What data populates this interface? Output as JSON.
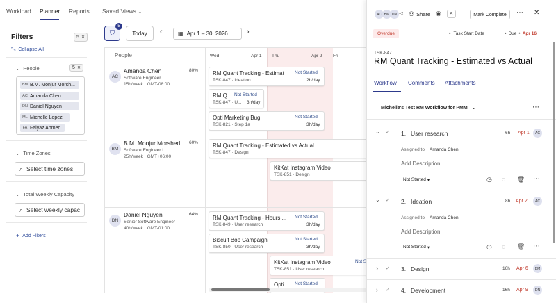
{
  "nav": {
    "tabs": [
      "Workload",
      "Planner",
      "Reports"
    ],
    "active": "Planner",
    "saved_views": "Saved Views"
  },
  "toolbar": {
    "filter_count": "5",
    "today": "Today",
    "date_range": "Apr 1 – 30, 2026"
  },
  "filters": {
    "title": "Filters",
    "count": "5",
    "collapse_all": "Collapse All",
    "people_label": "People",
    "people_count": "5",
    "people": [
      {
        "initials": "BM",
        "name": "B.M. Monjur Morsh..."
      },
      {
        "initials": "AC",
        "name": "Amanda Chen"
      },
      {
        "initials": "DN",
        "name": "Daniel Nguyen"
      },
      {
        "initials": "ML",
        "name": "Michelle Lopez"
      },
      {
        "initials": "FA",
        "name": "Faiyaz Ahmed"
      }
    ],
    "time_zones_label": "Time Zones",
    "time_zones_placeholder": "Select time zones",
    "capacity_label": "Total Weekly Capacity",
    "capacity_placeholder": "Select weekly capac",
    "add_filters": "Add Filters"
  },
  "planner": {
    "people_header": "People",
    "days": [
      {
        "dow": "Wed",
        "date": "Apr 1"
      },
      {
        "dow": "Thu",
        "date": "Apr 2"
      },
      {
        "dow": "Fri",
        "date": ""
      }
    ],
    "people": [
      {
        "initials": "AC",
        "name": "Amanda Chen",
        "role": "Software Engineer",
        "hours": "15h/week · GMT-08:00",
        "pct": "80%"
      },
      {
        "initials": "BM",
        "name": "B.M. Monjur Morshed",
        "role": "Software Engineer I",
        "hours": "25h/week · GMT+06:00",
        "pct": "60%"
      },
      {
        "initials": "DN",
        "name": "Daniel Nguyen",
        "role": "Senior Software Engineer",
        "hours": "40h/week · GMT-01:00",
        "pct": "64%"
      }
    ],
    "cards": [
      {
        "title": "RM Quant Tracking - Estimat",
        "sub": "TSK-847 · Ideation",
        "status": "Not Started",
        "hours": "2h/day"
      },
      {
        "title": "RM Q...",
        "sub": "TSK-847 · U...",
        "status": "Not Started",
        "hours": "3h/day"
      },
      {
        "title": "Opti Marketing Bug",
        "sub": "TSK-821 · Step 1a",
        "status": "Not Started",
        "hours": "3h/day"
      },
      {
        "title": "RM Quant Tracking - Estimated vs Actual",
        "sub": "TSK-847 · Design",
        "status": "",
        "hours": ""
      },
      {
        "title": "KitKat Instagram Video",
        "sub": "TSK-851 · Design",
        "status": "",
        "hours": ""
      },
      {
        "title": "RM Quant Tracking - Hours ...",
        "sub": "TSK-849 · User research",
        "status": "Not Started",
        "hours": "3h/day"
      },
      {
        "title": "Biscuit Bop Campaign",
        "sub": "TSK-850 · User research",
        "status": "Not Started",
        "hours": "3h/day"
      },
      {
        "title": "KitKat Instagram Video",
        "sub": "TSK-851 · User research",
        "status": "Not S",
        "hours": ""
      },
      {
        "title": "Opti...",
        "sub": "",
        "status": "Not Started",
        "hours": ""
      }
    ]
  },
  "detail": {
    "share_avatars": [
      "AC",
      "BM",
      "DN"
    ],
    "share_more": "+2",
    "share": "Share",
    "watchers": "5",
    "mark_complete": "Mark Complete",
    "overdue": "Overdue",
    "task_start_date": "Task Start Date",
    "due_label": "Due",
    "due_date": "Apr 16",
    "task_id": "TSK-847",
    "title": "RM Quant Tracking - Estimated vs Actual",
    "tabs": [
      "Workflow",
      "Comments",
      "Attachments"
    ],
    "active_tab": "Workflow",
    "workflow_name": "Michelle's Test RM Workflow for PMM",
    "steps": [
      {
        "num": "1.",
        "name": "User research",
        "hours": "6h",
        "date": "Apr 1",
        "avatar": "AC",
        "assigned_label": "Assigned to",
        "assignee": "Amanda Chen",
        "add_desc": "Add Description",
        "status": "Not Started",
        "expanded": true
      },
      {
        "num": "2.",
        "name": "Ideation",
        "hours": "8h",
        "date": "Apr 2",
        "avatar": "AC",
        "assigned_label": "Assigned to",
        "assignee": "Amanda Chen",
        "add_desc": "Add Description",
        "status": "Not Started",
        "expanded": true
      },
      {
        "num": "3.",
        "name": "Design",
        "hours": "16h",
        "date": "Apr 6",
        "avatar": "BM",
        "expanded": false
      },
      {
        "num": "4.",
        "name": "Development",
        "hours": "16h",
        "date": "Apr 9",
        "avatar": "DN",
        "expanded": false
      }
    ]
  },
  "colors": {
    "accent": "#2d3a8c",
    "overdue": "#c0392b",
    "due_date": "#c0392b",
    "weekend": "#fbecec"
  }
}
